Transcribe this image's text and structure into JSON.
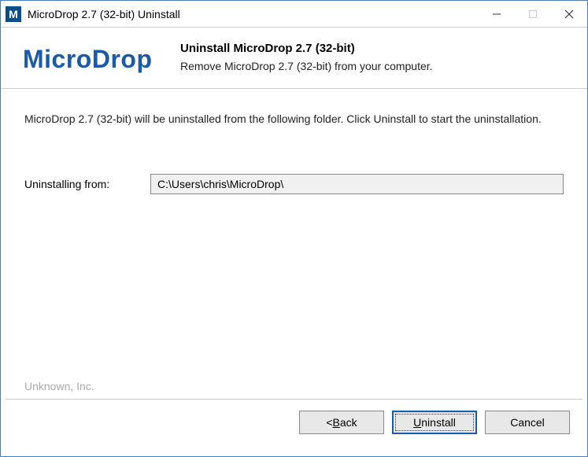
{
  "titlebar": {
    "app_icon_letter": "M",
    "title": "MicroDrop 2.7 (32-bit) Uninstall"
  },
  "header": {
    "logo": "MicroDrop",
    "title": "Uninstall MicroDrop 2.7 (32-bit)",
    "subtitle": "Remove MicroDrop 2.7 (32-bit) from your computer."
  },
  "content": {
    "instruction": "MicroDrop 2.7 (32-bit) will be uninstalled from the following folder. Click Uninstall to start the uninstallation.",
    "field_label": "Uninstalling from:",
    "field_value": "C:\\Users\\chris\\MicroDrop\\"
  },
  "footer": {
    "brand": "Unknown, Inc."
  },
  "buttons": {
    "back_prefix": "< ",
    "back_letter": "B",
    "back_rest": "ack",
    "uninstall_letter": "U",
    "uninstall_rest": "ninstall",
    "cancel": "Cancel"
  }
}
